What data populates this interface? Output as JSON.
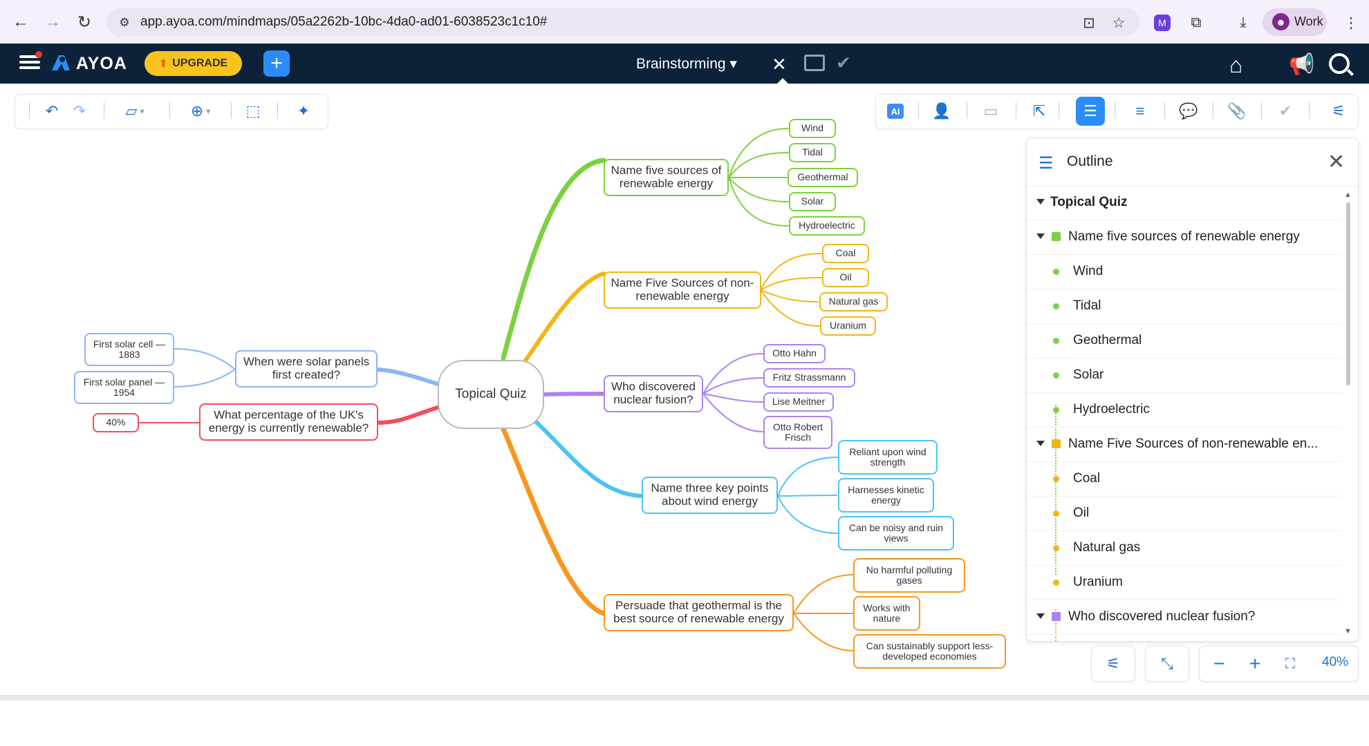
{
  "browser": {
    "url": "app.ayoa.com/mindmaps/05a2262b-10bc-4da0-ad01-6038523c1c10#",
    "profile_label": "Work"
  },
  "app": {
    "logo_text": "AYOA",
    "upgrade_label": "UPGRADE",
    "title": "Brainstorming",
    "title_caret": "▾"
  },
  "toolbar": {
    "ai_label": "AI"
  },
  "map": {
    "root": "Topical Quiz",
    "branches": [
      {
        "label": "Name five sources of renewable energy",
        "color": "#7bd140",
        "children": [
          "Wind",
          "Tidal",
          "Geothermal",
          "Solar",
          "Hydroelectric"
        ]
      },
      {
        "label": "Name Five Sources of non-renewable energy",
        "color": "#f3b515",
        "children": [
          "Coal",
          "Oil",
          "Natural gas",
          "Uranium"
        ]
      },
      {
        "label": "Who discovered nuclear fusion?",
        "color": "#ad82ef",
        "children": [
          "Otto Hahn",
          "Fritz Strassmann",
          "Lise Meitner",
          "Otto Robert Frisch"
        ]
      },
      {
        "label": "Name three key points about wind energy",
        "color": "#4dc3f3",
        "children": [
          "Reliant upon wind strength",
          "Harnesses kinetic energy",
          "Can be noisy and ruin views"
        ]
      },
      {
        "label": "Persuade that geothermal is the best source of renewable energy",
        "color": "#f9961c",
        "children": [
          "No harmful polluting gases",
          "Works with nature",
          "Can sustainably support less-developed economies"
        ]
      },
      {
        "label": "When were solar panels first created?",
        "color": "#8bb6f0",
        "children": [
          "First solar cell — 1883",
          "First solar panel — 1954"
        ]
      },
      {
        "label": "What percentage of the UK's energy is currently renewable?",
        "color": "#ef4f5a",
        "children": [
          "40%"
        ]
      }
    ]
  },
  "outline": {
    "title": "Outline",
    "items": [
      {
        "label": "Topical Quiz",
        "level": 0
      },
      {
        "label": "Name five sources of renewable energy",
        "level": 1,
        "color": "#7bd140"
      },
      {
        "label": "Wind",
        "level": 2,
        "color": "#7bd140"
      },
      {
        "label": "Tidal",
        "level": 2,
        "color": "#7bd140"
      },
      {
        "label": "Geothermal",
        "level": 2,
        "color": "#7bd140"
      },
      {
        "label": "Solar",
        "level": 2,
        "color": "#7bd140"
      },
      {
        "label": "Hydroelectric",
        "level": 2,
        "color": "#7bd140"
      },
      {
        "label": "Name Five Sources of non-renewable en...",
        "level": 1,
        "color": "#f3b515"
      },
      {
        "label": "Coal",
        "level": 2,
        "color": "#f3b515"
      },
      {
        "label": "Oil",
        "level": 2,
        "color": "#f3b515"
      },
      {
        "label": "Natural gas",
        "level": 2,
        "color": "#f3b515"
      },
      {
        "label": "Uranium",
        "level": 2,
        "color": "#f3b515"
      },
      {
        "label": "Who discovered nuclear fusion?",
        "level": 1,
        "color": "#ad82ef"
      }
    ]
  },
  "zoom": {
    "value": "40%"
  },
  "icons": [
    "back-icon",
    "forward-icon",
    "reload-icon",
    "site-info-icon",
    "install-icon",
    "star-icon",
    "extension-icon",
    "puzzle-icon",
    "download-icon",
    "more-icon",
    "hamburger-icon",
    "home-icon",
    "announce-icon",
    "search-icon",
    "undo-icon",
    "redo-icon",
    "shape-icon",
    "add-icon",
    "select-icon",
    "magic-icon",
    "share-icon",
    "present-icon",
    "export-icon",
    "outline-icon",
    "format-icon",
    "comment-icon",
    "attach-icon",
    "check-icon",
    "settings-icon",
    "layout-icon",
    "collapse-icon",
    "zoom-out-icon",
    "zoom-in-icon",
    "fit-icon"
  ]
}
